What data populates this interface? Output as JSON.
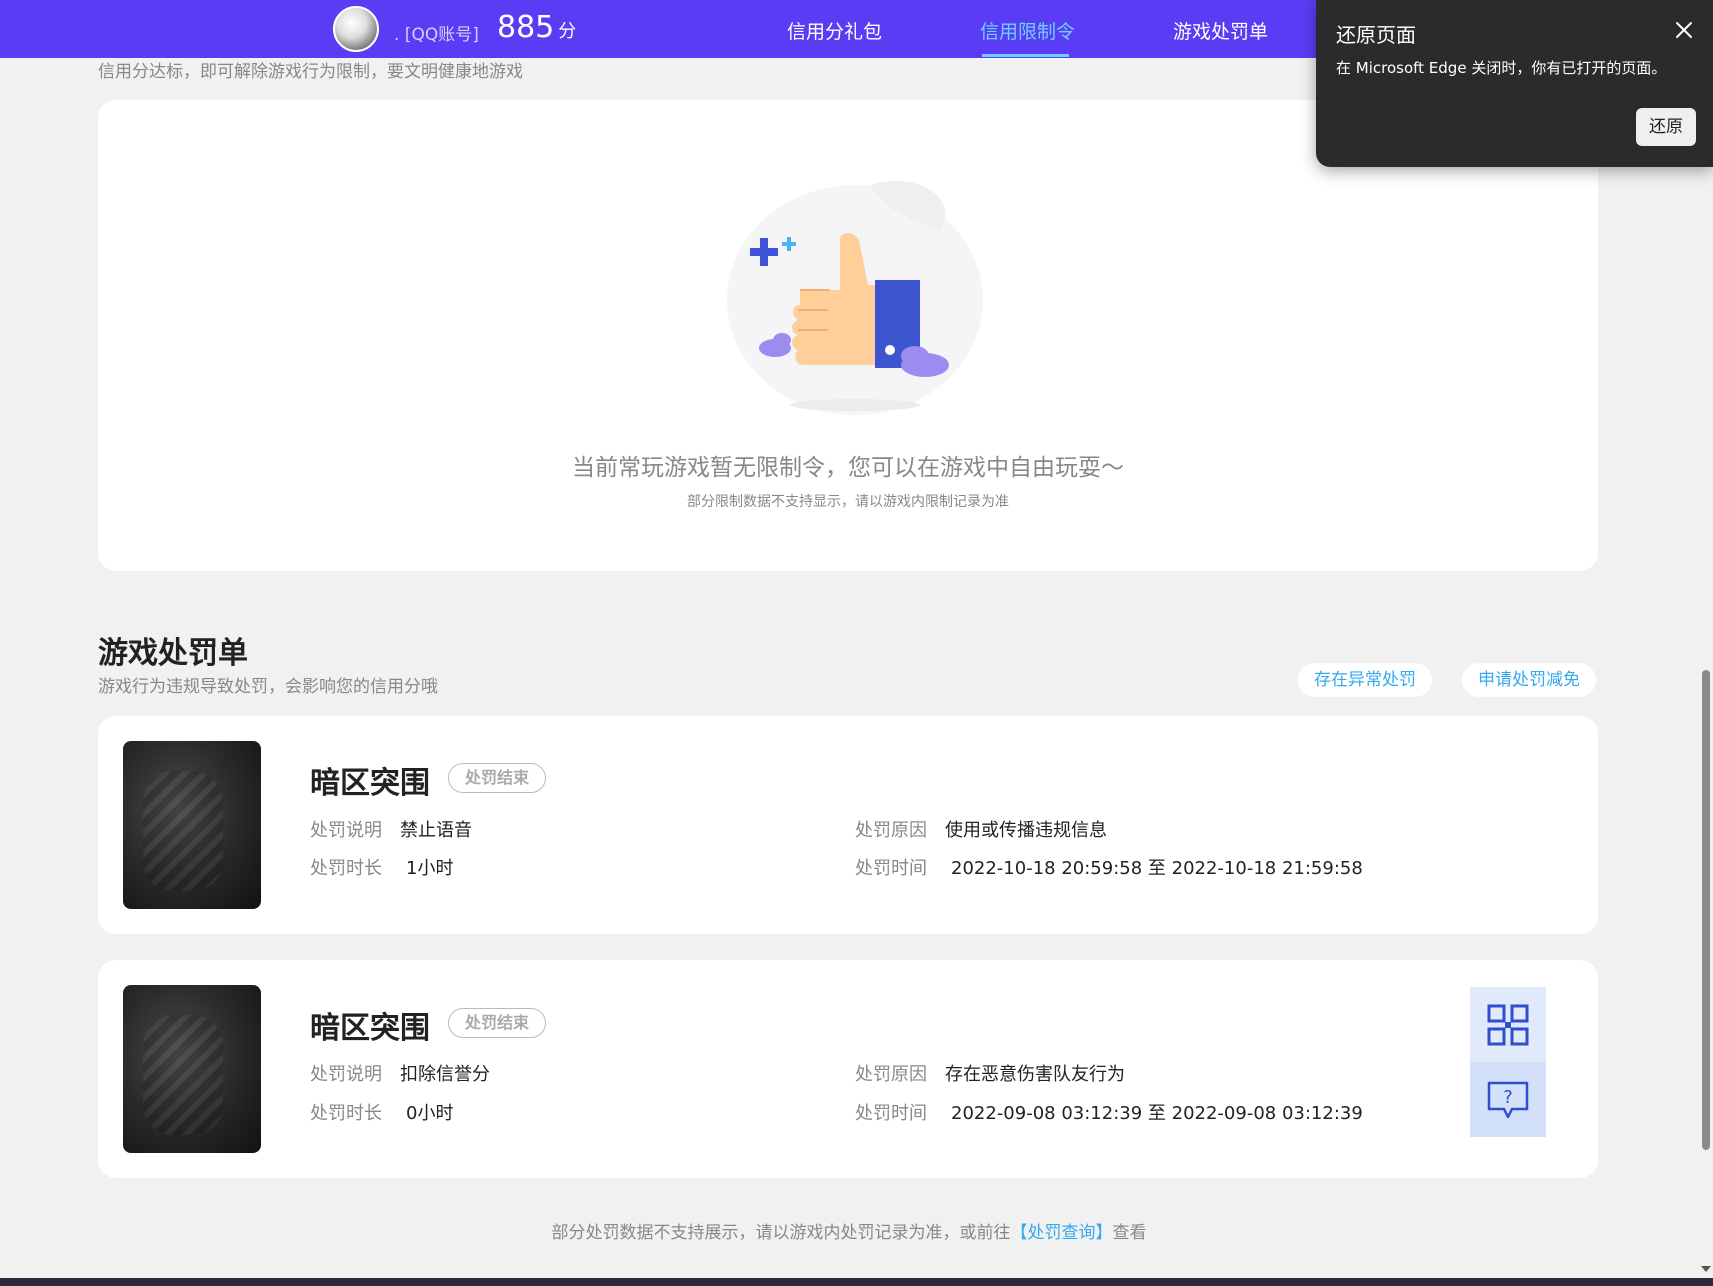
{
  "nav": {
    "account_label": ". [QQ账号]",
    "score": "885",
    "score_unit": "分",
    "items": [
      "信用分礼包",
      "信用限制令",
      "游戏处罚单"
    ]
  },
  "restriction": {
    "subtitle": "信用分达标，即可解除游戏行为限制，要文明健康地游戏",
    "empty_main": "当前常玩游戏暂无限制令，您可以在游戏中自由玩耍～",
    "empty_sub": "部分限制数据不支持显示，请以游戏内限制记录为准"
  },
  "penalty": {
    "title": "游戏处罚单",
    "subtitle": "游戏行为违规导致处罚，会影响您的信用分哦",
    "buttons": [
      "存在异常处罚",
      "申请处罚减免"
    ],
    "labels": {
      "desc": "处罚说明",
      "duration": "处罚时长",
      "reason": "处罚原因",
      "time": "处罚时间"
    },
    "records": [
      {
        "game": "暗区突围",
        "status": "处罚结束",
        "desc": "禁止语音",
        "duration": "1小时",
        "reason": "使用或传播违规信息",
        "time": "2022-10-18 20:59:58 至 2022-10-18 21:59:58"
      },
      {
        "game": "暗区突围",
        "status": "处罚结束",
        "desc": "扣除信誉分",
        "duration": "0小时",
        "reason": "存在恶意伤害队友行为",
        "time": "2022-09-08 03:12:39 至 2022-09-08 03:12:39"
      }
    ],
    "footer_prefix": "部分处罚数据不支持展示，请以游戏内处罚记录为准，或前往",
    "footer_link": "【处罚查询】",
    "footer_suffix": "查看"
  },
  "popup": {
    "title": "还原页面",
    "text": "在 Microsoft Edge 关闭时，你有已打开的页面。",
    "button": "还原"
  },
  "colors": {
    "nav_bg": "#5a3cf5",
    "accent": "#33aaf0",
    "active_tab": "#6fd0ff"
  }
}
